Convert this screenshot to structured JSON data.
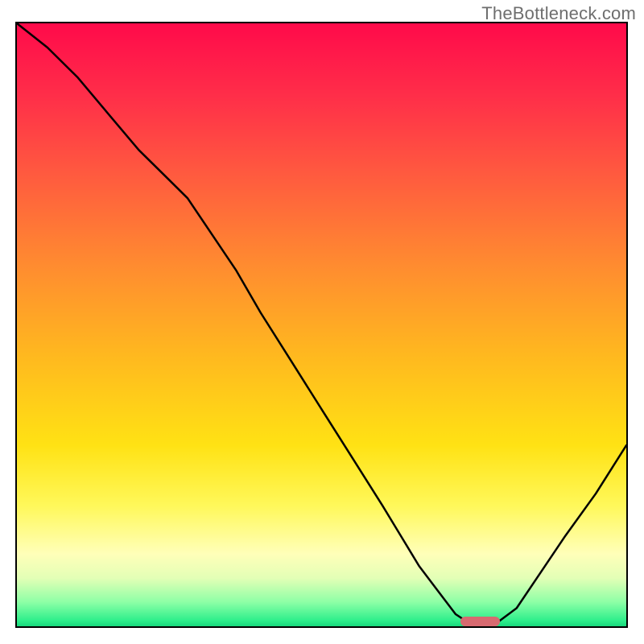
{
  "watermark": "TheBottleneck.com",
  "chart_data": {
    "type": "line",
    "title": "",
    "xlabel": "",
    "ylabel": "",
    "xlim": [
      0,
      100
    ],
    "ylim": [
      0,
      100
    ],
    "grid": false,
    "legend": false,
    "background": "vertical red-to-green gradient",
    "series": [
      {
        "name": "curve",
        "x": [
          0,
          5,
          10,
          15,
          20,
          25,
          28,
          32,
          36,
          40,
          45,
          50,
          55,
          60,
          63,
          66,
          69,
          72,
          75,
          78,
          82,
          86,
          90,
          95,
          100
        ],
        "y": [
          100,
          96,
          91,
          85,
          79,
          74,
          71,
          65,
          59,
          52,
          44,
          36,
          28,
          20,
          15,
          10,
          6,
          2,
          0,
          0,
          3,
          9,
          15,
          22,
          30
        ]
      }
    ],
    "marker": {
      "shape": "rounded-bar",
      "x_center": 76,
      "y_center": 0.8,
      "width_pct": 6.5,
      "height_pct": 1.6,
      "color": "#d76a70"
    }
  }
}
